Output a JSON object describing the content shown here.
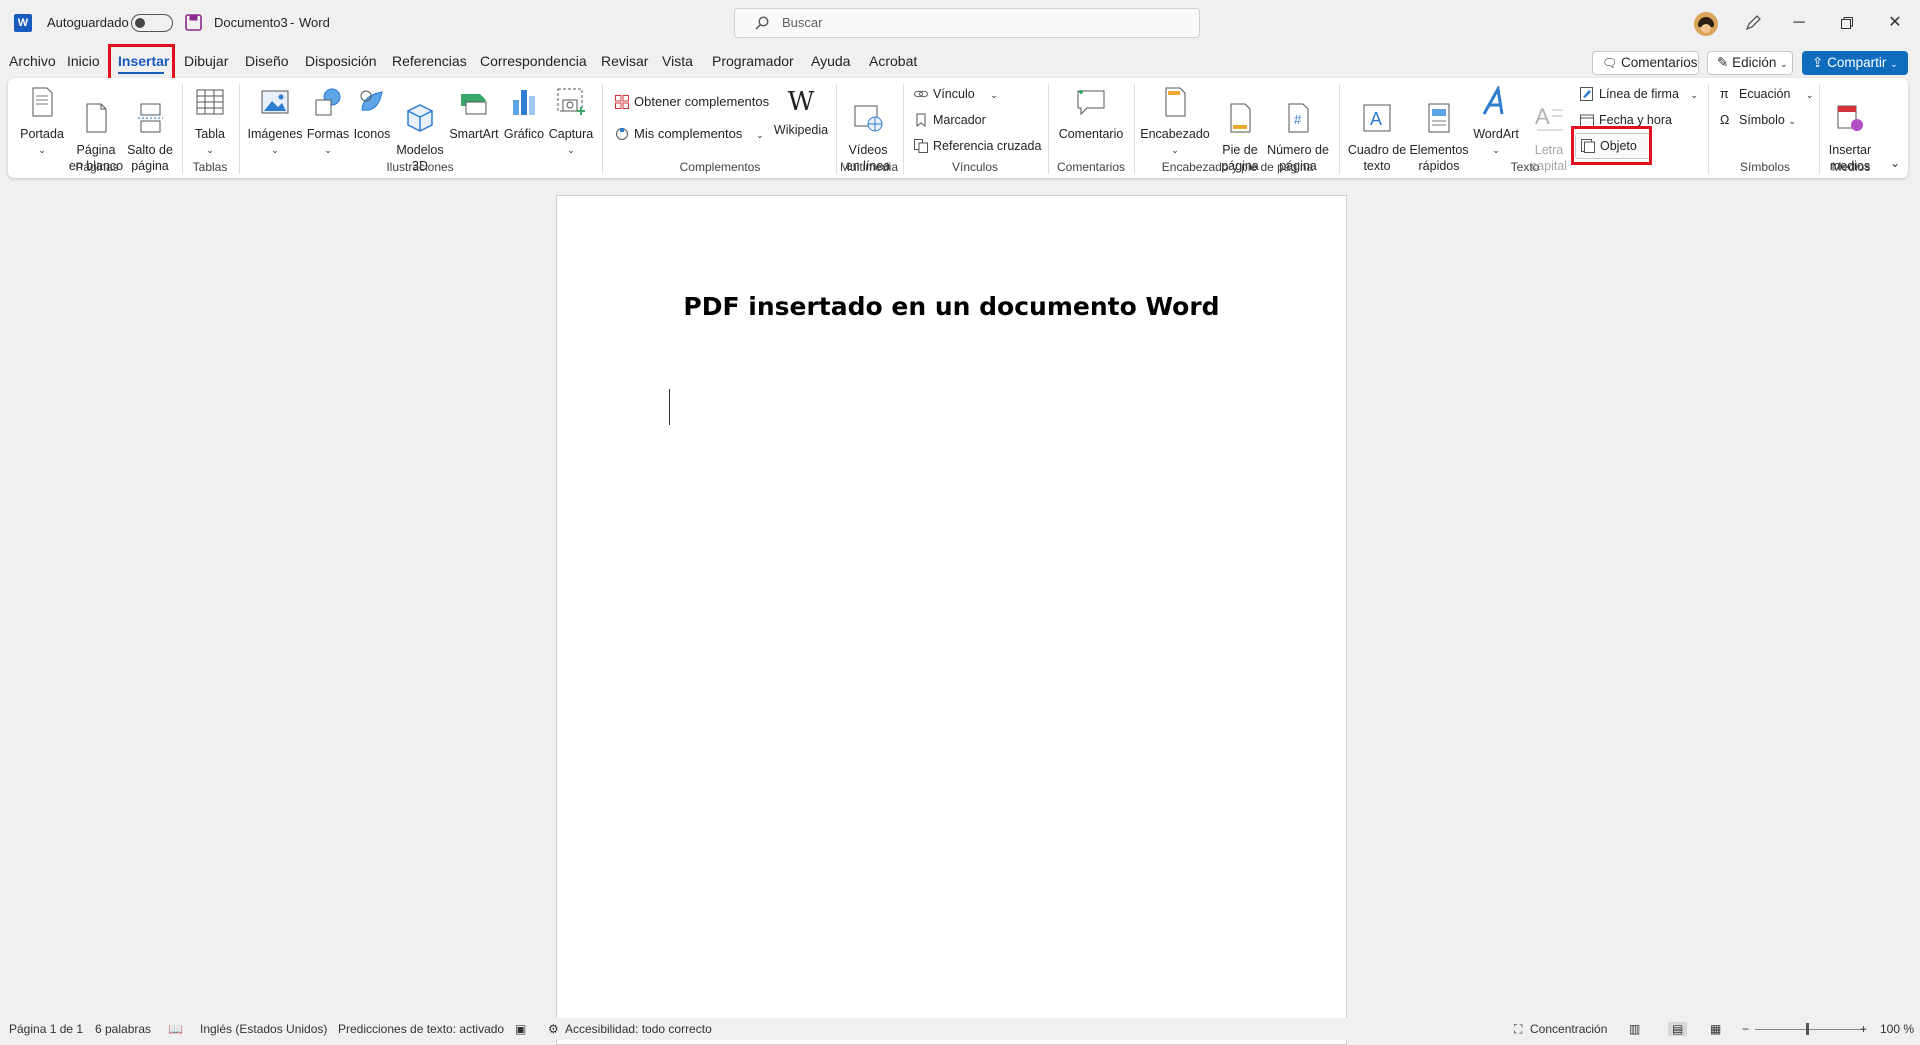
{
  "titlebar": {
    "autosave_label": "Autoguardado",
    "doc_name": "Documento3",
    "separator": "-",
    "app_name": "Word",
    "search_placeholder": "Buscar"
  },
  "menu": {
    "tabs": [
      "Archivo",
      "Inicio",
      "Insertar",
      "Dibujar",
      "Diseño",
      "Disposición",
      "Referencias",
      "Correspondencia",
      "Revisar",
      "Vista",
      "Programador",
      "Ayuda",
      "Acrobat"
    ],
    "active_tab": "Insertar",
    "comments_button": "Comentarios",
    "edit_mode_button": "Edición",
    "share_button": "Compartir"
  },
  "ribbon": {
    "paginas": {
      "label": "Páginas",
      "portada": "Portada",
      "pagina_blanco": "Página\nen blanco",
      "salto": "Salto de\npágina"
    },
    "tablas": {
      "label": "Tablas",
      "tabla": "Tabla"
    },
    "ilustraciones": {
      "label": "Ilustraciones",
      "imagenes": "Imágenes",
      "formas": "Formas",
      "iconos": "Iconos",
      "modelos": "Modelos\n3D",
      "smartart": "SmartArt",
      "grafico": "Gráfico",
      "captura": "Captura"
    },
    "complementos": {
      "label": "Complementos",
      "obtener": "Obtener complementos",
      "mis": "Mis complementos",
      "wikipedia": "Wikipedia"
    },
    "multimedia": {
      "label": "Multimedia",
      "videos": "Vídeos\nen línea"
    },
    "vinculos": {
      "label": "Vínculos",
      "vinculo": "Vínculo",
      "marcador": "Marcador",
      "referencia": "Referencia cruzada"
    },
    "comentarios": {
      "label": "Comentarios",
      "comentario": "Comentario"
    },
    "encabezado": {
      "label": "Encabezado y pie de página",
      "encabezado": "Encabezado",
      "pie": "Pie de\npágina",
      "numero": "Número de\npágina"
    },
    "texto": {
      "label": "Texto",
      "cuadro": "Cuadro de\ntexto",
      "elementos": "Elementos\nrápidos",
      "wordart": "WordArt",
      "letra": "Letra\ncapital",
      "linea_firma": "Línea de firma",
      "fecha_hora": "Fecha y hora",
      "objeto": "Objeto"
    },
    "simbolos": {
      "label": "Símbolos",
      "ecuacion": "Ecuación",
      "simbolo": "Símbolo"
    },
    "medios": {
      "label": "Medios",
      "insertar_medios": "Insertar\nmedios"
    }
  },
  "document": {
    "title": "PDF insertado en un documento Word"
  },
  "status": {
    "page": "Página 1 de 1",
    "words": "6 palabras",
    "language": "Inglés (Estados Unidos)",
    "predictions": "Predicciones de texto: activado",
    "accessibility": "Accesibilidad: todo correcto",
    "focus": "Concentración",
    "zoom": "100 %"
  },
  "colors": {
    "accent": "#185abd",
    "highlight": "#e0101c",
    "share": "#0f6cbd"
  }
}
